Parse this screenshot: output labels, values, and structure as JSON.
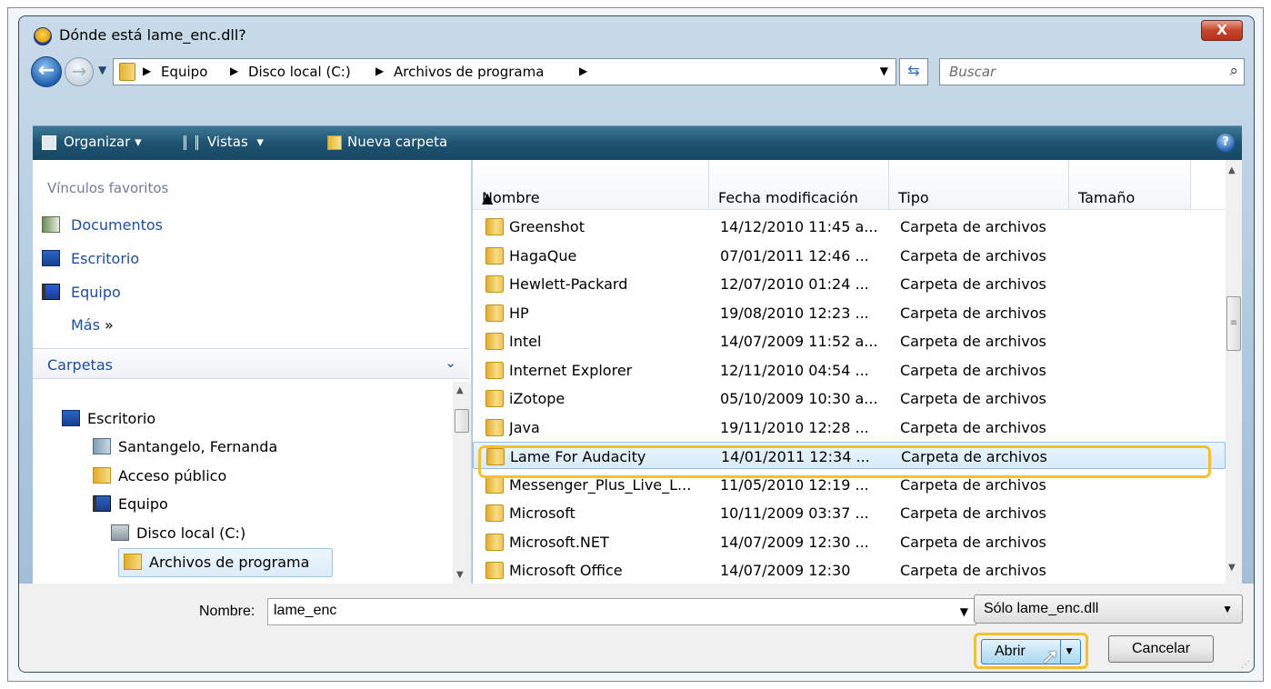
{
  "window": {
    "title": "Dónde está lame_enc.dll?",
    "close_label": "X"
  },
  "navigation": {
    "breadcrumbs": [
      "Equipo",
      "Disco local (C:)",
      "Archivos de programa"
    ],
    "search_placeholder": "Buscar"
  },
  "toolbar": {
    "organize_label": "Organizar",
    "views_label": "Vistas",
    "new_folder_label": "Nueva carpeta"
  },
  "favorites": {
    "header": "Vínculos favoritos",
    "items": [
      {
        "label": "Documentos",
        "icon": "documents-icon"
      },
      {
        "label": "Escritorio",
        "icon": "desktop-icon"
      },
      {
        "label": "Equipo",
        "icon": "computer-icon"
      }
    ],
    "more_label": "Más",
    "more_glyph": "»"
  },
  "folders": {
    "header": "Carpetas",
    "tree": [
      {
        "label": "Escritorio",
        "icon": "desktop-icon"
      },
      {
        "label": "Santangelo, Fernanda",
        "icon": "user-folder-icon"
      },
      {
        "label": "Acceso público",
        "icon": "folder-icon"
      },
      {
        "label": "Equipo",
        "icon": "computer-icon"
      },
      {
        "label": "Disco local (C:)",
        "icon": "drive-icon"
      },
      {
        "label": "Archivos de programa",
        "icon": "folder-icon",
        "selected": true
      }
    ]
  },
  "file_list": {
    "columns": [
      "Nombre",
      "Fecha modificación",
      "Tipo",
      "Tamaño"
    ],
    "rows": [
      {
        "name": "Greenshot",
        "date": "14/12/2010 11:45 a...",
        "type": "Carpeta de archivos"
      },
      {
        "name": "HagaQue",
        "date": "07/01/2011 12:46 ...",
        "type": "Carpeta de archivos"
      },
      {
        "name": "Hewlett-Packard",
        "date": "12/07/2010 01:24 ...",
        "type": "Carpeta de archivos"
      },
      {
        "name": "HP",
        "date": "19/08/2010 12:23 ...",
        "type": "Carpeta de archivos"
      },
      {
        "name": "Intel",
        "date": "14/07/2009 11:52 a...",
        "type": "Carpeta de archivos"
      },
      {
        "name": "Internet Explorer",
        "date": "12/11/2010 04:54 ...",
        "type": "Carpeta de archivos"
      },
      {
        "name": "iZotope",
        "date": "05/10/2009 10:30 a...",
        "type": "Carpeta de archivos"
      },
      {
        "name": "Java",
        "date": "19/11/2010 12:28 ...",
        "type": "Carpeta de archivos"
      },
      {
        "name": "Lame For Audacity",
        "date": "14/01/2011 12:34 ...",
        "type": "Carpeta de archivos",
        "selected": true
      },
      {
        "name": "Messenger_Plus_Live_L...",
        "date": "11/05/2010 12:19 ...",
        "type": "Carpeta de archivos"
      },
      {
        "name": "Microsoft",
        "date": "10/11/2009 03:37 ...",
        "type": "Carpeta de archivos"
      },
      {
        "name": "Microsoft.NET",
        "date": "14/07/2009 12:30 ...",
        "type": "Carpeta de archivos"
      },
      {
        "name": "Microsoft Office",
        "date": "14/07/2009 12:30",
        "type": "Carpeta de archivos"
      }
    ]
  },
  "footer": {
    "name_label": "Nombre:",
    "name_value": "lame_enc",
    "filter_value": "Sólo lame_enc.dll",
    "open_label": "Abrir",
    "cancel_label": "Cancelar"
  },
  "colors": {
    "highlight_outline": "#f2c12d",
    "toolbar_bg": "#1e5370",
    "link_blue": "#1d4e9a"
  }
}
